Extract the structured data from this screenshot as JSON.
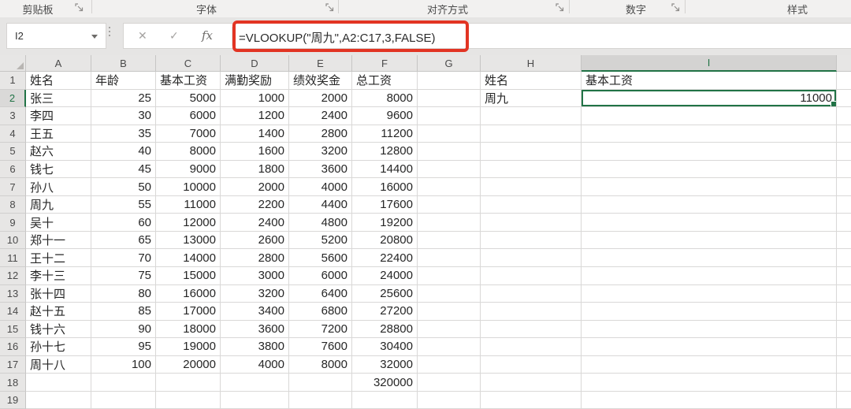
{
  "ribbon": {
    "groups": [
      {
        "label": "剪贴板"
      },
      {
        "label": "字体"
      },
      {
        "label": "对齐方式"
      },
      {
        "label": "数字"
      },
      {
        "label": "样式"
      }
    ]
  },
  "formula_bar": {
    "name_box": "I2",
    "cancel_icon": "✕",
    "enter_icon": "✓",
    "fx_icon": "fx",
    "formula": "=VLOOKUP(\"周九\",A2:C17,3,FALSE)"
  },
  "selection": {
    "cell_ref": "I2",
    "row": 2,
    "column": "I",
    "value": "11000"
  },
  "colors": {
    "accent_green": "#217346",
    "annotation_red": "#e23423"
  },
  "grid": {
    "column_letters": [
      "A",
      "B",
      "C",
      "D",
      "E",
      "F",
      "G",
      "H",
      "I"
    ],
    "rows": [
      {
        "n": 1,
        "cells": [
          "姓名",
          "年龄",
          "基本工资",
          "满勤奖励",
          "绩效奖金",
          "总工资",
          "",
          "姓名",
          "基本工资"
        ]
      },
      {
        "n": 2,
        "cells": [
          "张三",
          "25",
          "5000",
          "1000",
          "2000",
          "8000",
          "",
          "周九",
          "11000"
        ]
      },
      {
        "n": 3,
        "cells": [
          "李四",
          "30",
          "6000",
          "1200",
          "2400",
          "9600",
          "",
          "",
          ""
        ]
      },
      {
        "n": 4,
        "cells": [
          "王五",
          "35",
          "7000",
          "1400",
          "2800",
          "11200",
          "",
          "",
          ""
        ]
      },
      {
        "n": 5,
        "cells": [
          "赵六",
          "40",
          "8000",
          "1600",
          "3200",
          "12800",
          "",
          "",
          ""
        ]
      },
      {
        "n": 6,
        "cells": [
          "钱七",
          "45",
          "9000",
          "1800",
          "3600",
          "14400",
          "",
          "",
          ""
        ]
      },
      {
        "n": 7,
        "cells": [
          "孙八",
          "50",
          "10000",
          "2000",
          "4000",
          "16000",
          "",
          "",
          ""
        ]
      },
      {
        "n": 8,
        "cells": [
          "周九",
          "55",
          "11000",
          "2200",
          "4400",
          "17600",
          "",
          "",
          ""
        ]
      },
      {
        "n": 9,
        "cells": [
          "吴十",
          "60",
          "12000",
          "2400",
          "4800",
          "19200",
          "",
          "",
          ""
        ]
      },
      {
        "n": 10,
        "cells": [
          "郑十一",
          "65",
          "13000",
          "2600",
          "5200",
          "20800",
          "",
          "",
          ""
        ]
      },
      {
        "n": 11,
        "cells": [
          "王十二",
          "70",
          "14000",
          "2800",
          "5600",
          "22400",
          "",
          "",
          ""
        ]
      },
      {
        "n": 12,
        "cells": [
          "李十三",
          "75",
          "15000",
          "3000",
          "6000",
          "24000",
          "",
          "",
          ""
        ]
      },
      {
        "n": 13,
        "cells": [
          "张十四",
          "80",
          "16000",
          "3200",
          "6400",
          "25600",
          "",
          "",
          ""
        ]
      },
      {
        "n": 14,
        "cells": [
          "赵十五",
          "85",
          "17000",
          "3400",
          "6800",
          "27200",
          "",
          "",
          ""
        ]
      },
      {
        "n": 15,
        "cells": [
          "钱十六",
          "90",
          "18000",
          "3600",
          "7200",
          "28800",
          "",
          "",
          ""
        ]
      },
      {
        "n": 16,
        "cells": [
          "孙十七",
          "95",
          "19000",
          "3800",
          "7600",
          "30400",
          "",
          "",
          ""
        ]
      },
      {
        "n": 17,
        "cells": [
          "周十八",
          "100",
          "20000",
          "4000",
          "8000",
          "32000",
          "",
          "",
          ""
        ]
      },
      {
        "n": 18,
        "cells": [
          "",
          "",
          "",
          "",
          "",
          "320000",
          "",
          "",
          ""
        ]
      },
      {
        "n": 19,
        "cells": [
          "",
          "",
          "",
          "",
          "",
          "",
          "",
          "",
          ""
        ]
      }
    ]
  }
}
